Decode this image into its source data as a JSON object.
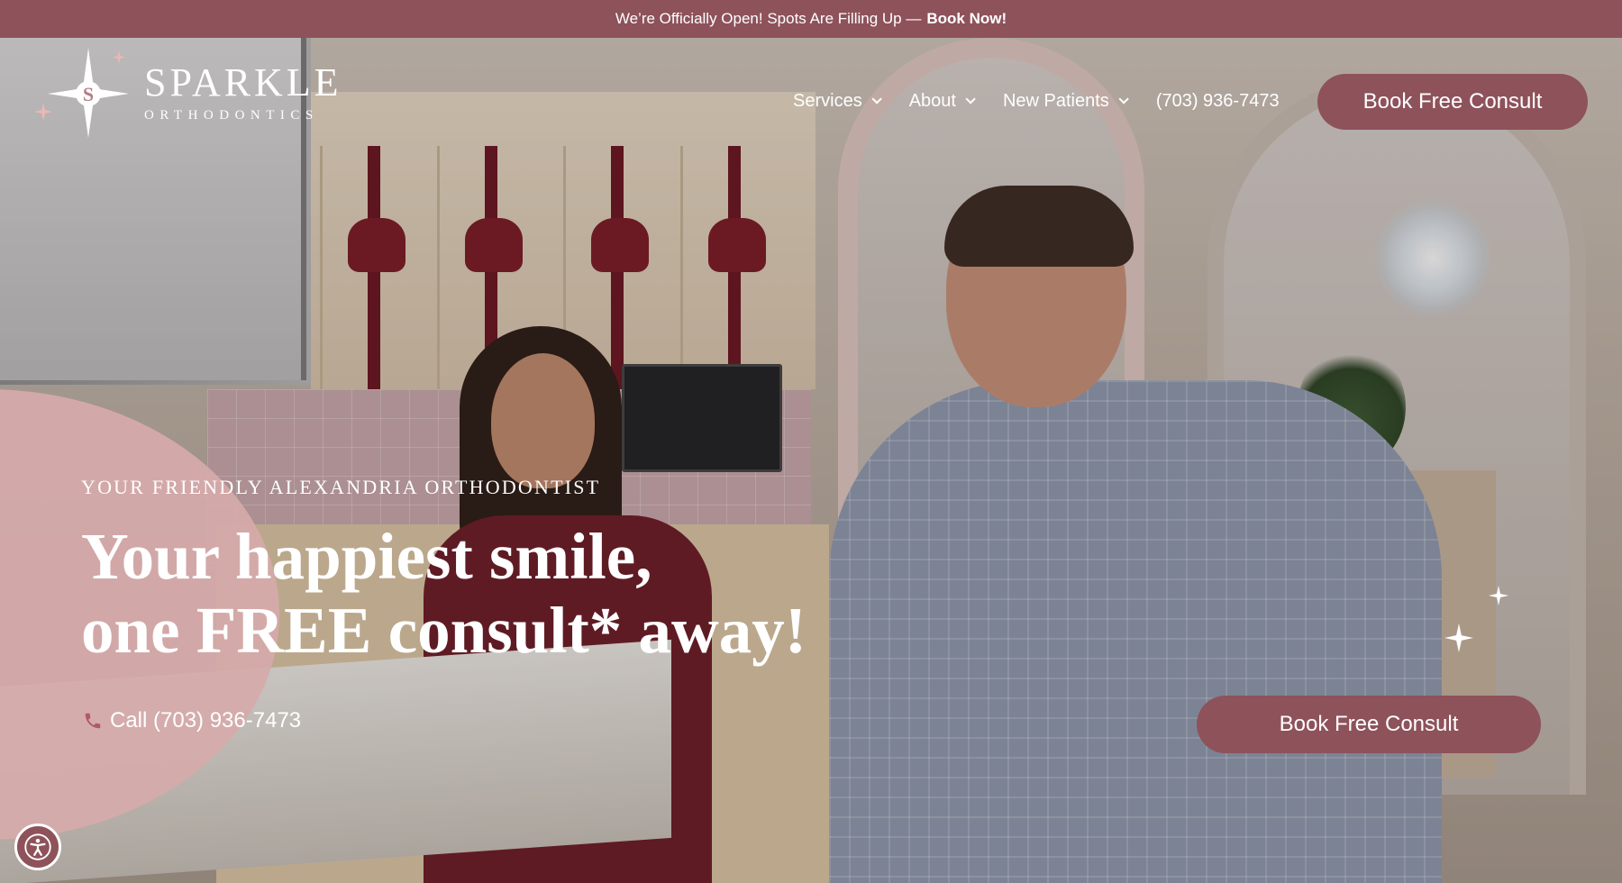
{
  "announcement": {
    "text": "We’re Officially Open! Spots Are Filling Up —",
    "cta": "Book Now!"
  },
  "logo": {
    "name": "SPARKLE",
    "subtitle": "ORTHODONTICS",
    "icon": "sparkle-star-icon"
  },
  "nav": {
    "items": [
      {
        "label": "Services",
        "has_dropdown": true
      },
      {
        "label": "About",
        "has_dropdown": true
      },
      {
        "label": "New Patients",
        "has_dropdown": true
      }
    ],
    "phone": "(703) 936-7473",
    "cta": "Book Free Consult"
  },
  "hero": {
    "eyebrow": "YOUR FRIENDLY ALEXANDRIA ORTHODONTIST",
    "headline_line1": "Your happiest smile,",
    "headline_line2": "one FREE consult* away!",
    "call_label": "Call (703) 936-7473",
    "call_icon": "phone-icon",
    "cta": "Book Free Consult"
  },
  "accessibility": {
    "icon": "accessibility-icon"
  },
  "colors": {
    "brand": "#8e525b",
    "accent_pink": "#d6aaaa",
    "text_light": "#ffffff"
  }
}
